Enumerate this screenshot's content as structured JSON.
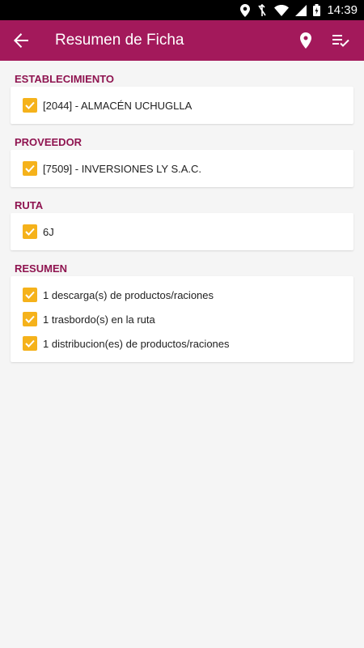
{
  "status": {
    "time": "14:39"
  },
  "app_bar": {
    "title": "Resumen de Ficha",
    "icons": [
      "arrow-back-icon",
      "location-pin-icon",
      "playlist-check-icon"
    ]
  },
  "colors": {
    "primary": "#a3195b",
    "section_label": "#8f1450",
    "checkbox": "#f5b21b"
  },
  "sections": [
    {
      "label": "ESTABLECIMIENTO",
      "items": [
        "[2044] - ALMACÉN UCHUGLLA"
      ]
    },
    {
      "label": "PROVEEDOR",
      "items": [
        "[7509] - INVERSIONES LY S.A.C."
      ]
    },
    {
      "label": "RUTA",
      "items": [
        "6J"
      ]
    },
    {
      "label": "RESUMEN",
      "items": [
        "1 descarga(s) de productos/raciones",
        "1 trasbordo(s) en la ruta",
        "1 distribucion(es) de productos/raciones"
      ]
    }
  ]
}
